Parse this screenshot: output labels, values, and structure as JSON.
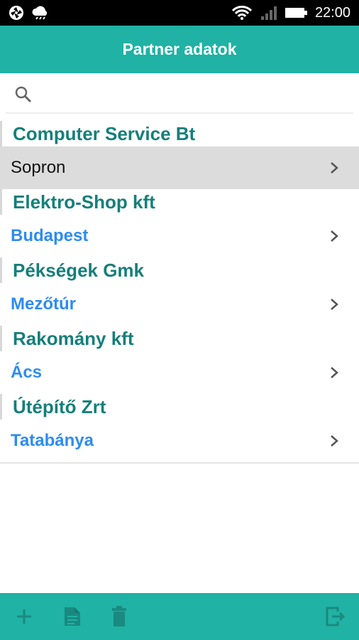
{
  "status_bar": {
    "time": "22:00",
    "icons": [
      "aperture-icon",
      "cloud-icon",
      "wifi-icon",
      "signal-icon",
      "battery-icon"
    ]
  },
  "header": {
    "title": "Partner adatok"
  },
  "search": {
    "placeholder": "",
    "value": ""
  },
  "partners": [
    {
      "name": "Computer Service Bt",
      "city": "Sopron",
      "selected": true
    },
    {
      "name": "Elektro-Shop kft",
      "city": "Budapest",
      "selected": false
    },
    {
      "name": "Pékségek Gmk",
      "city": "Mezőtúr",
      "selected": false
    },
    {
      "name": "Rakomány kft",
      "city": "Ács",
      "selected": false
    },
    {
      "name": "Útépítő Zrt",
      "city": "Tatabánya",
      "selected": false
    }
  ],
  "bottom_bar": {
    "buttons": [
      "add-icon",
      "document-icon",
      "trash-icon",
      "exit-icon"
    ]
  },
  "colors": {
    "accent": "#20b2a4",
    "partner_name": "#157f7a",
    "city_link": "#2d8cf0",
    "selected_bg": "#dcdcdc",
    "bottom_icon": "#1a8a80"
  }
}
